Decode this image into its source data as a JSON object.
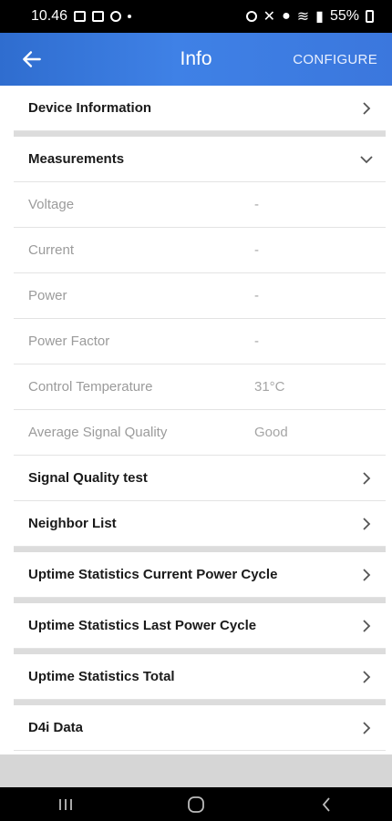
{
  "status_bar": {
    "time": "10.46",
    "battery": "55%"
  },
  "app_bar": {
    "title": "Info",
    "action": "CONFIGURE"
  },
  "sections": {
    "device_information": "Device Information",
    "measurements": "Measurements",
    "signal_quality_test": "Signal Quality test",
    "neighbor_list": "Neighbor List",
    "uptime_current": "Uptime Statistics Current Power Cycle",
    "uptime_last": "Uptime Statistics Last Power Cycle",
    "uptime_total": "Uptime Statistics Total",
    "d4i_data": "D4i Data"
  },
  "measurements": [
    {
      "label": "Voltage",
      "value": "-"
    },
    {
      "label": "Current",
      "value": "-"
    },
    {
      "label": "Power",
      "value": "-"
    },
    {
      "label": "Power Factor",
      "value": "-"
    },
    {
      "label": "Control Temperature",
      "value": "31°C"
    },
    {
      "label": "Average Signal Quality",
      "value": "Good"
    }
  ]
}
